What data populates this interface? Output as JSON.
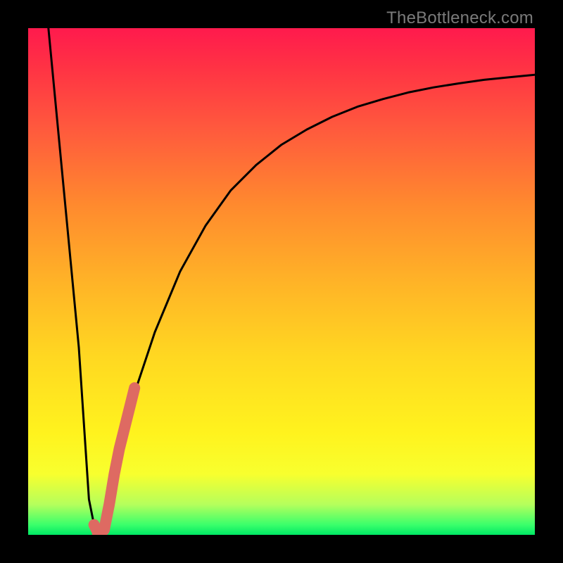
{
  "watermark": "TheBottleneck.com",
  "chart_data": {
    "type": "line",
    "title": "",
    "xlabel": "",
    "ylabel": "",
    "xlim": [
      0,
      100
    ],
    "ylim": [
      0,
      100
    ],
    "series": [
      {
        "name": "bottleneck-curve",
        "color": "#000000",
        "x": [
          4,
          6,
          8,
          10,
          11,
          12,
          13,
          14,
          15,
          17,
          20,
          25,
          30,
          35,
          40,
          45,
          50,
          55,
          60,
          65,
          70,
          75,
          80,
          85,
          90,
          95,
          100
        ],
        "y": [
          100,
          79,
          58,
          37,
          22,
          7,
          2,
          0,
          1,
          12,
          25,
          40,
          52,
          61,
          68,
          73,
          77,
          80,
          82.5,
          84.5,
          86,
          87.3,
          88.3,
          89.1,
          89.8,
          90.3,
          90.8
        ]
      },
      {
        "name": "highlight-segment",
        "color": "#de6a62",
        "x": [
          13,
          14,
          15,
          16,
          17,
          18,
          19,
          20,
          21
        ],
        "y": [
          2,
          0,
          1,
          6,
          12,
          17,
          21,
          25,
          29
        ]
      }
    ],
    "gradient_stops": [
      {
        "pos": 0,
        "color": "#ff1a4d"
      },
      {
        "pos": 8,
        "color": "#ff3344"
      },
      {
        "pos": 20,
        "color": "#ff5a3d"
      },
      {
        "pos": 35,
        "color": "#ff8a2e"
      },
      {
        "pos": 50,
        "color": "#ffb327"
      },
      {
        "pos": 65,
        "color": "#ffd821"
      },
      {
        "pos": 80,
        "color": "#fff31e"
      },
      {
        "pos": 88,
        "color": "#f8ff2e"
      },
      {
        "pos": 94,
        "color": "#b5ff5c"
      },
      {
        "pos": 98,
        "color": "#3bff6b"
      },
      {
        "pos": 100,
        "color": "#00e865"
      }
    ]
  }
}
